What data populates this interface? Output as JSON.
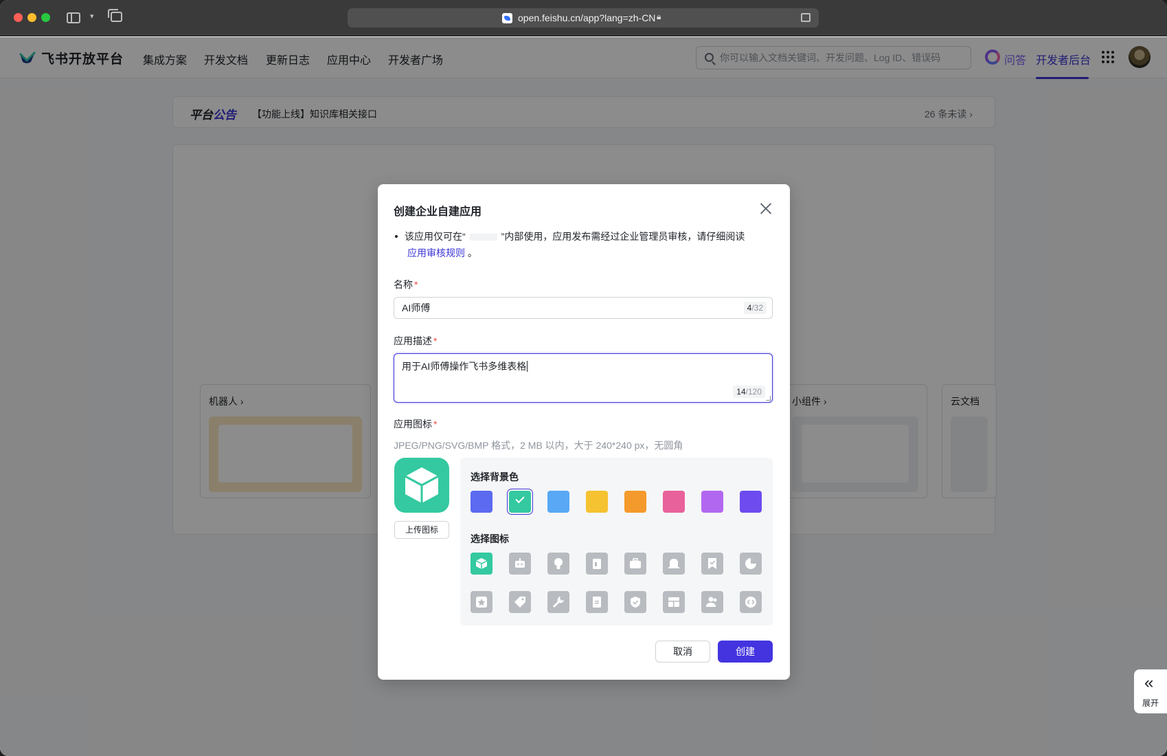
{
  "browser": {
    "url": "open.feishu.cn/app?lang=zh-CN"
  },
  "nav": {
    "logo_text": "飞书开放平台",
    "items": [
      "集成方案",
      "开发文档",
      "更新日志",
      "应用中心",
      "开发者广场"
    ],
    "search_placeholder": "你可以输入文档关键词、开发问题、Log ID、错误码",
    "qa_label": "问答",
    "console_label": "开发者后台"
  },
  "notice": {
    "tag_a": "平台",
    "tag_b": "公告",
    "text": "【功能上线】知识库相关接口",
    "unread": "26 条未读 ›"
  },
  "capabilities": {
    "bot": "机器人 ›",
    "widget": "小组件 ›",
    "docs": "云文档"
  },
  "expand_tab": {
    "label": "展开"
  },
  "modal": {
    "title": "创建企业自建应用",
    "tip_before": "该应用仅可在“",
    "tip_after": "”内部使用，应用发布需经过企业管理员审核，请仔细阅读",
    "tip_link": "应用审核规则",
    "tip_end": "。",
    "name_label": "名称",
    "name_value": "AI师傅",
    "name_count": "4",
    "name_max": "/32",
    "desc_label": "应用描述",
    "desc_value": "用于AI师傅操作飞书多维表格",
    "desc_count": "14",
    "desc_max": "/120",
    "icon_label": "应用图标",
    "icon_hint": "JPEG/PNG/SVG/BMP 格式，2 MB 以内，大于 240*240 px，无圆角",
    "upload_label": "上传图标",
    "bg_title": "选择背景色",
    "icon_title": "选择图标",
    "bg_colors": [
      "#5b6af0",
      "#34c9a0",
      "#58a8f5",
      "#f5c231",
      "#f49a2c",
      "#e9619b",
      "#b267f0",
      "#6d4bef"
    ],
    "selected_bg": 1,
    "icons": [
      "cube-icon",
      "robot-icon",
      "lightbulb-icon",
      "document-icon",
      "briefcase-icon",
      "bell-icon",
      "bookmark-check-icon",
      "pie-chart-icon",
      "star-badge-icon",
      "tag-icon",
      "wrench-icon",
      "file-icon",
      "shield-check-icon",
      "layout-icon",
      "people-icon",
      "code-icon"
    ],
    "selected_icon": 0,
    "cancel_label": "取消",
    "create_label": "创建"
  }
}
